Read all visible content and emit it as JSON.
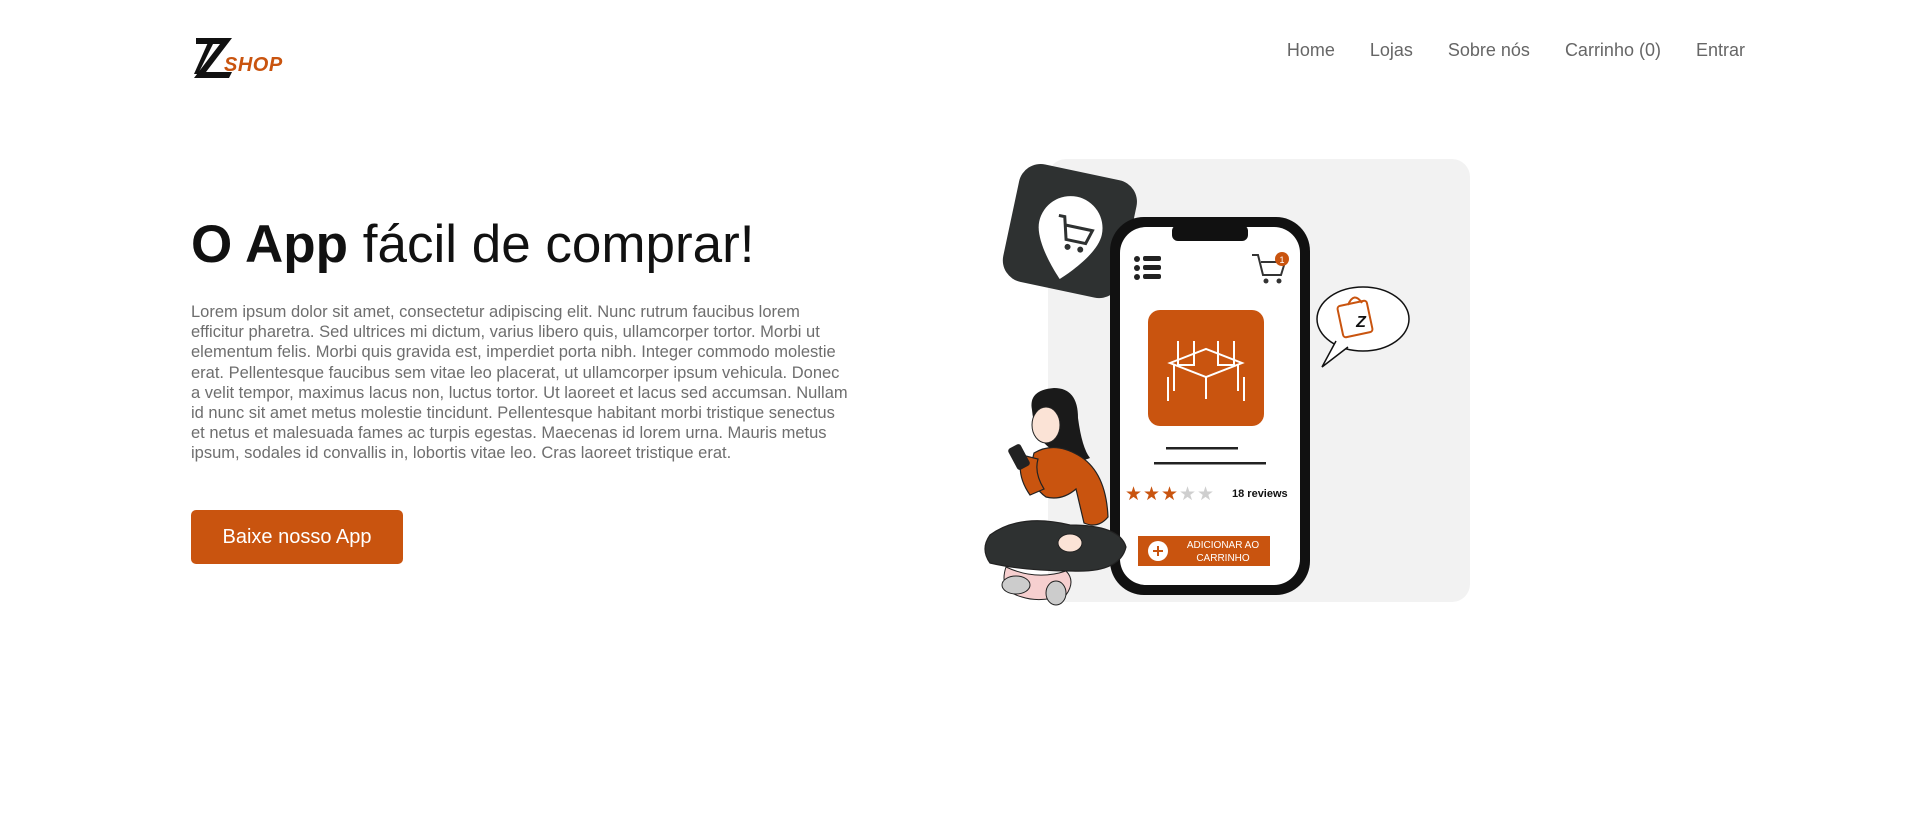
{
  "brand": {
    "logo_letter": "Z",
    "logo_text": "SHOP",
    "accent_color": "#c9540f"
  },
  "nav": {
    "items": [
      {
        "label": "Home"
      },
      {
        "label": "Lojas"
      },
      {
        "label": "Sobre nós"
      },
      {
        "label": "Carrinho (0)"
      },
      {
        "label": "Entrar"
      }
    ]
  },
  "hero": {
    "title_bold": "O App",
    "title_rest": " fácil de comprar!",
    "description": "Lorem ipsum dolor sit amet, consectetur adipiscing elit. Nunc rutrum faucibus lorem efficitur pharetra. Sed ultrices mi dictum, varius libero quis, ullamcorper tortor. Morbi ut elementum felis. Morbi quis gravida est, imperdiet porta nibh. Integer commodo molestie erat. Pellentesque faucibus sem vitae leo placerat, ut ullamcorper ipsum vehicula. Donec a velit tempor, maximus lacus non, luctus tortor. Ut laoreet et lacus sed accumsan. Nullam id nunc sit amet metus molestie tincidunt. Pellentesque habitant morbi tristique senectus et netus et malesuada fames ac turpis egestas. Maecenas id lorem urna. Mauris metus ipsum, sodales id convallis in, lobortis vitae leo. Cras laoreet tristique erat.",
    "cta_label": "Baixe nosso App"
  },
  "illustration": {
    "cart_badge": "1",
    "rating_stars": 3,
    "rating_max": 5,
    "reviews_label": "18 reviews",
    "add_to_cart_line1": "ADICIONAR AO",
    "add_to_cart_line2": "CARRINHO",
    "bubble_logo": "Z"
  }
}
